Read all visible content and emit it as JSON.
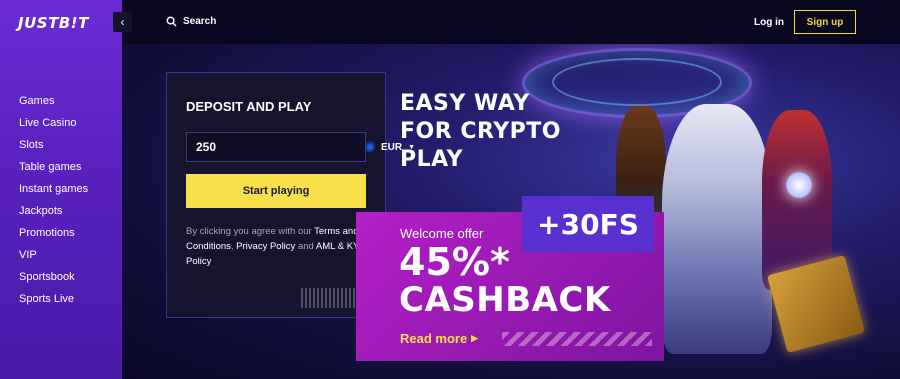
{
  "brand": {
    "logo_text": "JUSTB!T"
  },
  "sidebar": {
    "collapse_icon": "chevron-left-icon",
    "items": [
      {
        "label": "Games"
      },
      {
        "label": "Live Casino"
      },
      {
        "label": "Slots"
      },
      {
        "label": "Table games"
      },
      {
        "label": "Instant games"
      },
      {
        "label": "Jackpots"
      },
      {
        "label": "Promotions"
      },
      {
        "label": "VIP"
      },
      {
        "label": "Sportsbook"
      },
      {
        "label": "Sports Live"
      }
    ]
  },
  "header": {
    "search_label": "Search",
    "login_label": "Log in",
    "signup_label": "Sign up"
  },
  "hero": {
    "headline_line1": "EASY WAY",
    "headline_line2": "FOR CRYPTO",
    "headline_line3": "PLAY"
  },
  "deposit": {
    "title": "DEPOSIT AND PLAY",
    "amount_value": "250",
    "currency": "EUR",
    "start_label": "Start playing",
    "legal_prefix": "By clicking you agree with our",
    "terms_label": "Terms and Conditions",
    "legal_comma": ",",
    "privacy_label": "Privacy Policy",
    "legal_and": "and",
    "aml_label": "AML & KYC Policy"
  },
  "promo": {
    "fs_badge": "+30FS",
    "welcome_label": "Welcome offer",
    "cashback_percent": "45%*",
    "cashback_word": "CASHBACK",
    "read_more_label": "Read more",
    "read_more_arrow": "▸"
  },
  "colors": {
    "accent_yellow": "#f7e04a",
    "sidebar_purple": "#5a22c0",
    "promo_magenta": "#b51ec9",
    "fs_violet": "#5a2fd0"
  }
}
